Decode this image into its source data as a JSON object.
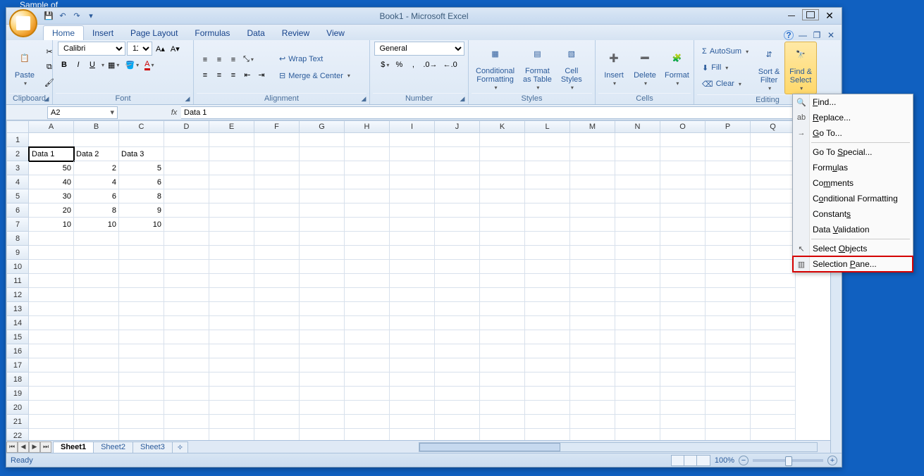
{
  "desktop": {
    "hint": "Sample of"
  },
  "title": "Book1 - Microsoft Excel",
  "tabs": [
    "Home",
    "Insert",
    "Page Layout",
    "Formulas",
    "Data",
    "Review",
    "View"
  ],
  "activeTab": "Home",
  "ribbon": {
    "clipboard": {
      "label": "Clipboard",
      "paste": "Paste"
    },
    "font": {
      "label": "Font",
      "name": "Calibri",
      "size": "11",
      "bold": "B",
      "italic": "I",
      "underline": "U"
    },
    "alignment": {
      "label": "Alignment",
      "wrap": "Wrap Text",
      "merge": "Merge & Center"
    },
    "number": {
      "label": "Number",
      "format": "General"
    },
    "styles": {
      "label": "Styles",
      "cond": "Conditional\nFormatting",
      "tbl": "Format\nas Table",
      "cell": "Cell\nStyles"
    },
    "cells": {
      "label": "Cells",
      "insert": "Insert",
      "delete": "Delete",
      "format": "Format"
    },
    "editing": {
      "label": "Editing",
      "autosum": "AutoSum",
      "fill": "Fill",
      "clear": "Clear",
      "sort": "Sort &\nFilter",
      "find": "Find &\nSelect"
    }
  },
  "namebox": "A2",
  "formula": "Data 1",
  "columns": [
    "A",
    "B",
    "C",
    "D",
    "E",
    "F",
    "G",
    "H",
    "I",
    "J",
    "K",
    "L",
    "M",
    "N",
    "O",
    "P",
    "Q"
  ],
  "rowCount": 22,
  "cells": {
    "A2": "Data 1",
    "B2": "Data 2",
    "C2": "Data 3",
    "A3": "50",
    "B3": "2",
    "C3": "5",
    "A4": "40",
    "B4": "4",
    "C4": "6",
    "A5": "30",
    "B5": "6",
    "C5": "8",
    "A6": "20",
    "B6": "8",
    "C6": "9",
    "A7": "10",
    "B7": "10",
    "C7": "10"
  },
  "selectedCell": "A2",
  "sheets": [
    "Sheet1",
    "Sheet2",
    "Sheet3"
  ],
  "activeSheet": "Sheet1",
  "status": {
    "ready": "Ready",
    "zoom": "100%"
  },
  "menu": {
    "items": [
      {
        "icon": "🔍",
        "label": "Find...",
        "u": 0
      },
      {
        "icon": "ab",
        "label": "Replace...",
        "u": 0
      },
      {
        "icon": "→",
        "label": "Go To...",
        "u": 0
      },
      {
        "sep": true
      },
      {
        "label": "Go To Special...",
        "u": 6
      },
      {
        "label": "Formulas",
        "u": 4
      },
      {
        "label": "Comments",
        "u": 2
      },
      {
        "label": "Conditional Formatting",
        "u": 1
      },
      {
        "label": "Constants",
        "u": 8
      },
      {
        "label": "Data Validation",
        "u": 5
      },
      {
        "sep": true
      },
      {
        "icon": "↖",
        "label": "Select Objects",
        "u": 7
      },
      {
        "icon": "▥",
        "label": "Selection Pane...",
        "u": 10,
        "hl": true
      }
    ]
  }
}
